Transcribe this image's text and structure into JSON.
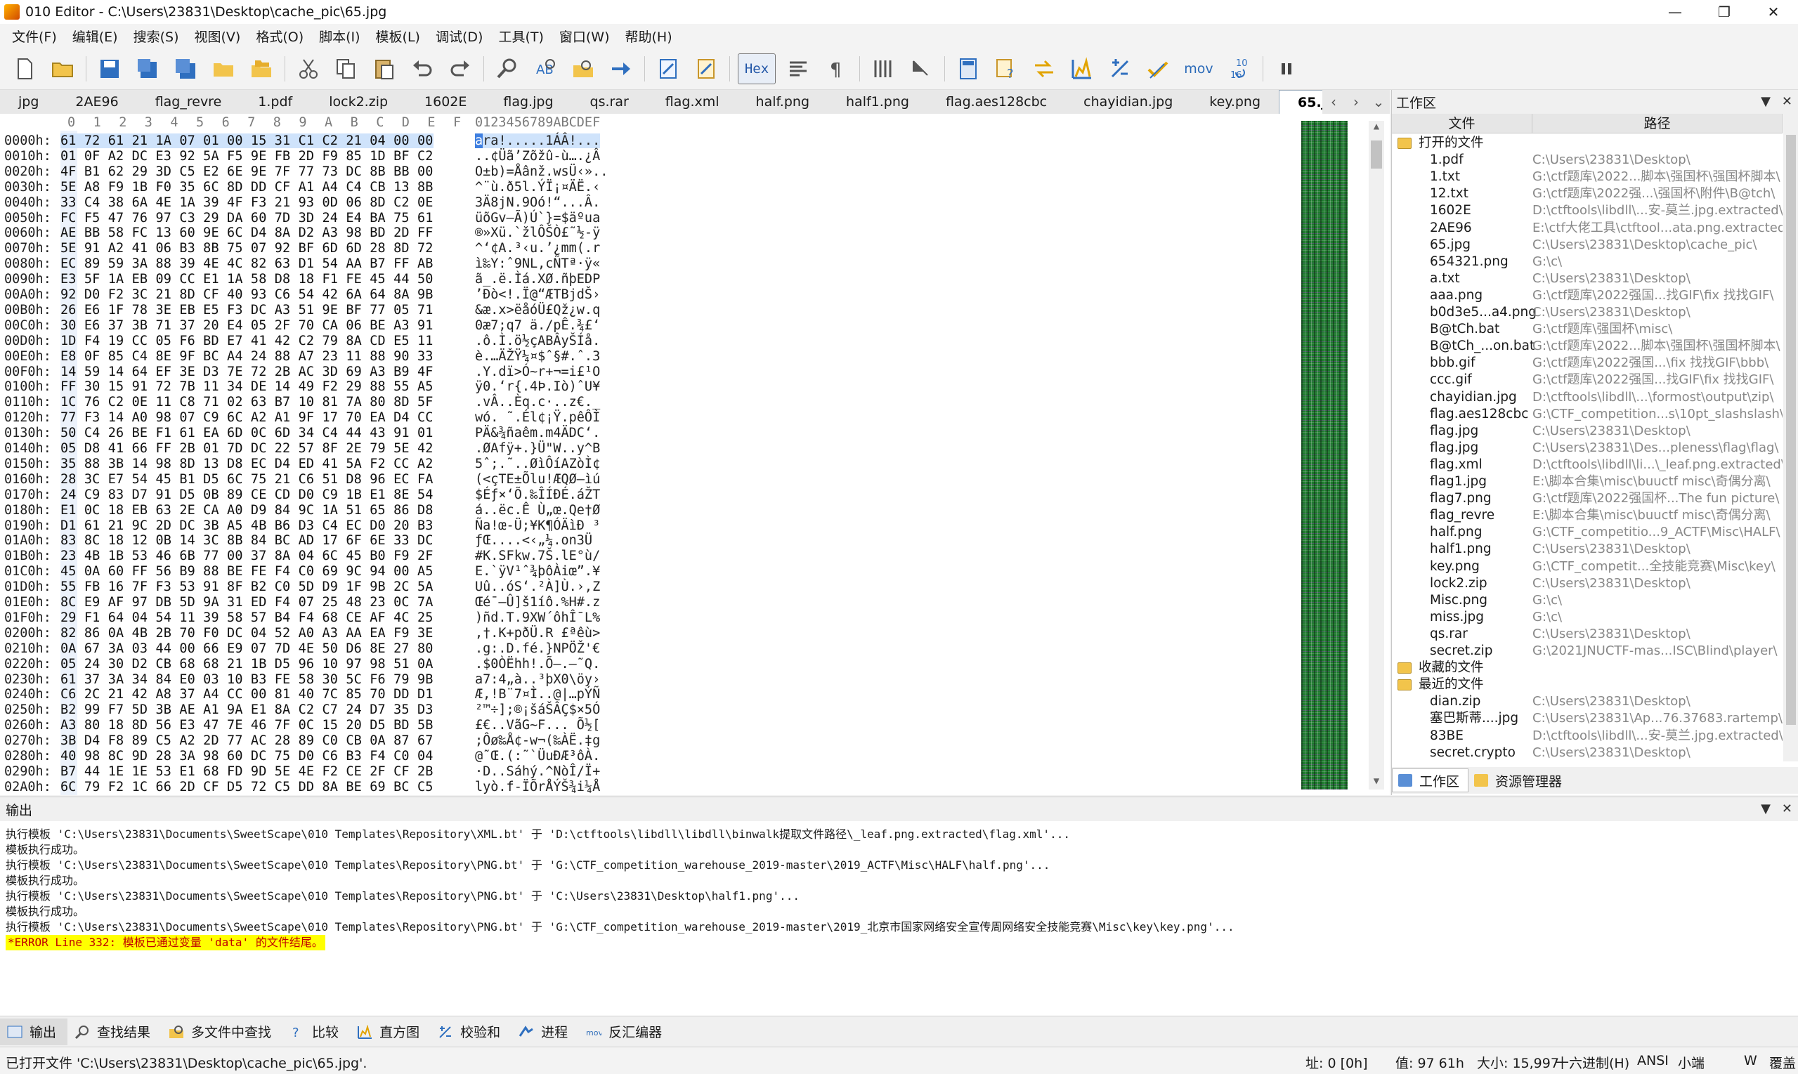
{
  "window": {
    "title": "010 Editor - C:\\Users\\23831\\Desktop\\cache_pic\\65.jpg",
    "min": "—",
    "max": "❐",
    "close": "✕"
  },
  "menu": [
    "文件(F)",
    "编辑(E)",
    "搜索(S)",
    "视图(V)",
    "格式(O)",
    "脚本(I)",
    "模板(L)",
    "调试(D)",
    "工具(T)",
    "窗口(W)",
    "帮助(H)"
  ],
  "toolbar": {
    "hex_label": "Hex",
    "mov_label": "mov",
    "counter_top": "10",
    "counter_bot": "16"
  },
  "tabs": [
    "jpg",
    "2AE96",
    "flag_revre",
    "1.pdf",
    "lock2.zip",
    "1602E",
    "flag.jpg",
    "qs.rar",
    "flag.xml",
    "half.png",
    "half1.png",
    "flag.aes128cbc",
    "chayidian.jpg",
    "key.png"
  ],
  "active_tab": {
    "label": "65.jpg",
    "close": "✕"
  },
  "tabnav": {
    "prev": "‹",
    "next": "›",
    "list": "⌄"
  },
  "hex": {
    "header_cols": [
      "0",
      "1",
      "2",
      "3",
      "4",
      "5",
      "6",
      "7",
      "8",
      "9",
      "A",
      "B",
      "C",
      "D",
      "E",
      "F"
    ],
    "ascii_header": "0123456789ABCDEF",
    "rows": [
      {
        "a": "0000h:",
        "b": "61 72 61 21 1A 07 01 00 15 31 C1 C2 21 04 00 00",
        "t": "ara!.....1ÁÂ!..."
      },
      {
        "a": "0010h:",
        "b": "01 0F A2 DC E3 92 5A F5 9E FB 2D F9 85 1D BF C2",
        "t": "..¢Üã’Zõž­û-ù….¿Â"
      },
      {
        "a": "0020h:",
        "b": "4F B1 62 29 3D C5 E2 6E 9E 7F 77 73 DC 8B BB 00",
        "t": "O±b)=Åânž.wsÜ‹».."
      },
      {
        "a": "0030h:",
        "b": "5E A8 F9 1B F0 35 6C 8D DD CF A1 A4 C4 CB 13 8B",
        "t": "^¨ù.ð5l.ÝÏ¡¤ÄË.‹"
      },
      {
        "a": "0040h:",
        "b": "33 C4 38 6A 4E 1A 39 4F F3 21 93 0D 06 8D C2 0E",
        "t": "3Ä8jN.9Oó!“...Â."
      },
      {
        "a": "0050h:",
        "b": "FC F5 47 76 97 C3 29 DA 60 7D 3D 24 E4 BA 75 61",
        "t": "üõGv—Ã)Ú`}=$äºua"
      },
      {
        "a": "0060h:",
        "b": "AE BB 58 FC 13 60 9E 6C D4 8A D2 A3 98 BD 2D FF",
        "t": "®»Xü.`žlÔŠÒ£˜½-ÿ"
      },
      {
        "a": "0070h:",
        "b": "5E 91 A2 41 06 B3 8B 75 07 92 BF 6D 6D 28 8D 72",
        "t": "^‘¢A.³‹u.’¿mm(.r"
      },
      {
        "a": "0080h:",
        "b": "EC 89 59 3A 88 39 4E 4C 82 63 D1 54 AA B7 FF AB",
        "t": "ì‰Y:ˆ9NL‚cÑTª·ÿ«"
      },
      {
        "a": "0090h:",
        "b": "E3 5F 1A EB 09 CC E1 1A 58 D8 18 F1 FE 45 44 50",
        "t": "ã_.ë.Ìá.XØ.ñþEDP"
      },
      {
        "a": "00A0h:",
        "b": "92 D0 F2 3C 21 8D CF 40 93 C6 54 42 6A 64 8A 9B",
        "t": "’Ðò<!.Ï@“ÆTBjdŠ›"
      },
      {
        "a": "00B0h:",
        "b": "26 E6 1F 78 3E EB E5 F3 DC A3 51 9E BF 77 05 71",
        "t": "&æ.x>ëåóÜ£Qž¿w.q"
      },
      {
        "a": "00C0h:",
        "b": "30 E6 37 3B 71 37 20 E4 05 2F 70 CA 06 BE A3 91",
        "t": "0æ7;q7 ä./pÊ.¾£‘"
      },
      {
        "a": "00D0h:",
        "b": "1D F4 19 CC 05 F6 BD E7 41 42 C2 79 8A CD E5 11",
        "t": ".ô.Ì.ö½çABÂyŠÍå."
      },
      {
        "a": "00E0h:",
        "b": "E8 0F 85 C4 8E 9F BC A4 24 88 A7 23 11 88 90 33",
        "t": "è.…ÄŽŸ¼¤$ˆ§#.ˆ.3"
      },
      {
        "a": "00F0h:",
        "b": "14 59 14 64 EF 3E D3 7E 72 2B AC 3D 69 A3 B9 4F",
        "t": ".Y.dï>Ó~r+¬=i£¹O"
      },
      {
        "a": "0100h:",
        "b": "FF 30 15 91 72 7B 11 34 DE 14 49 F2 29 88 55 A5",
        "t": "ÿ0.‘r{.4Þ.Iò)ˆU¥"
      },
      {
        "a": "0110h:",
        "b": "1C 76 C2 0E 11 C8 71 02 63 B7 10 81 7A 80 8D 5F",
        "t": ".vÂ..Èq.c·..z€._"
      },
      {
        "a": "0120h:",
        "b": "77 F3 14 A0 98 07 C9 6C A2 A1 9F 17 70 EA D4 CC",
        "t": "wó. ˜.Él¢¡Ÿ.pêÔÌ"
      },
      {
        "a": "0130h:",
        "b": "50 C4 26 BE F1 61 EA 6D 0C 6D 34 C4 44 43 91 01",
        "t": "PÄ&¾ñaêm.m4ÄDC‘."
      },
      {
        "a": "0140h:",
        "b": "05 D8 41 66 FF 2B 01 7D DC 22 57 8F 2E 79 5E 42",
        "t": ".ØAfÿ+.}Ü\"W..y^B"
      },
      {
        "a": "0150h:",
        "b": "35 88 3B 14 98 8D 13 D8 EC D4 ED 41 5A F2 CC A2",
        "t": "5ˆ;.˜..ØìÔíAZòÌ¢"
      },
      {
        "a": "0160h:",
        "b": "28 3C E7 54 45 B1 D5 6C 75 21 C6 51 D8 96 EC FA",
        "t": "(<çTE±Õlu!ÆQØ–ìú"
      },
      {
        "a": "0170h:",
        "b": "24 C9 83 D7 91 D5 0B 89 CE CD D0 C9 1B E1 8E 54",
        "t": "$Éƒ×‘Õ.‰ÎÍÐÉ.áŽT"
      },
      {
        "a": "0180h:",
        "b": "E1 0C 18 EB 63 2E CA A0 D9 84 9C 1A 51 65 86 D8",
        "t": "á..ëc.Ê Ù„œ.Qe†Ø"
      },
      {
        "a": "0190h:",
        "b": "D1 61 21 9C 2D DC 3B A5 4B B6 D3 C4 EC D0 20 B3",
        "t": "Ña!œ-Ü;¥K¶ÓÄìÐ ³"
      },
      {
        "a": "01A0h:",
        "b": "83 8C 18 12 0B 14 3C 8B 84 BC AD 17 6F 6E 33 DC",
        "t": "ƒŒ....<‹„¼­.on3Ü"
      },
      {
        "a": "01B0h:",
        "b": "23 4B 1B 53 46 6B 77 00 37 8A 04 6C 45 B0 F9 2F",
        "t": "#K.SFkw.7Š.lE°ù/"
      },
      {
        "a": "01C0h:",
        "b": "45 0A 60 FF 56 B9 88 BE FE F4 C0 69 9C 94 00 A5",
        "t": "E.`ÿV¹ˆ¾þôÀiœ”.¥"
      },
      {
        "a": "01D0h:",
        "b": "55 FB 16 7F F3 53 91 8F B2 C0 5D D9 1F 9B 2C 5A",
        "t": "Uû..óS‘.²À]Ù.›,Z"
      },
      {
        "a": "01E0h:",
        "b": "8C E9 AF 97 DB 5D 9A 31 ED F4 07 25 48 23 0C 7A",
        "t": "Œé¯—Û]š1íô.%H#.z"
      },
      {
        "a": "01F0h:",
        "b": "29 F1 64 04 54 11 39 58 57 B4 F4 68 CE AF 4C 25",
        "t": ")ñd.T.9XW´ôhÎ¯L%"
      },
      {
        "a": "0200h:",
        "b": "82 86 0A 4B 2B 70 F0 DC 04 52 A0 A3 AA EA F9 3E",
        "t": "‚†.K+pðÜ.R £ªêù>"
      },
      {
        "a": "0210h:",
        "b": "0A 67 3A 03 44 00 66 E9 07 7D 4E 50 D6 8E 27 80",
        "t": ".g:.D.fé.}NPÖŽ'€"
      },
      {
        "a": "0220h:",
        "b": "05 24 30 D2 CB 68 68 21 1B D5 96 10 97 98 51 0A",
        "t": ".$0ÒËhh!.Õ–.—˜Q."
      },
      {
        "a": "0230h:",
        "b": "61 37 3A 34 84 E0 03 10 B3 FE 58 30 5C F6 79 9B",
        "t": "a7:4„à..³þX0\\öy›"
      },
      {
        "a": "0240h:",
        "b": "C6 2C 21 42 A8 37 A4 CC 00 81 40 7C 85 70 DD D1",
        "t": "Æ,!B¨7¤Ì..@|…pÝÑ"
      },
      {
        "a": "0250h:",
        "b": "B2 99 F7 5D 3B AE A1 9A E1 8A C2 C7 24 D7 35 D3",
        "t": "²™÷];®¡šáŠÂÇ$×5Ó"
      },
      {
        "a": "0260h:",
        "b": "A3 80 18 8D 56 E3 47 7E 46 7F 0C 15 20 D5 BD 5B",
        "t": "£€..VãG~F... Õ½["
      },
      {
        "a": "0270h:",
        "b": "3B D4 F8 89 C5 A2 2D 77 AC 28 89 C0 CB 0A 87 67",
        "t": ";Ôø‰Å¢-w¬(‰ÀË.‡g"
      },
      {
        "a": "0280h:",
        "b": "40 98 8C 9D 28 3A 98 60 DC 75 D0 C6 B3 F4 C0 04",
        "t": "@˜Œ.(:˜`ÜuÐÆ³ôÀ."
      },
      {
        "a": "0290h:",
        "b": "B7 44 1E 1E 53 E1 68 FD 9D 5E 4E F2 CE 2F CF 2B",
        "t": "·D..Sáhý.^NòÎ/Ï+"
      },
      {
        "a": "02A0h:",
        "b": "6C 79 F2 1C 66 2D CF D5 72 C5 DD 8A BE 69 BC C5",
        "t": "lyò.f-ÏÕrÅÝŠ¾i¼Å"
      }
    ]
  },
  "workspace": {
    "title": "工作区",
    "col_file": "文件",
    "col_path": "路径",
    "group_open": "打开的文件",
    "open_files": [
      {
        "n": "1.pdf",
        "p": "C:\\Users\\23831\\Desktop\\"
      },
      {
        "n": "1.txt",
        "p": "G:\\ctf题库\\2022...脚本\\强国杯\\强国杯脚本\\"
      },
      {
        "n": "12.txt",
        "p": "G:\\ctf题库\\2022强...\\强国杯\\附件\\B@tch\\"
      },
      {
        "n": "1602E",
        "p": "D:\\ctftools\\libdll\\...安-莫兰.jpg.extracted\\"
      },
      {
        "n": "2AE96",
        "p": "E:\\ctf大佬工具\\ctftool...ata.png.extracted\\"
      },
      {
        "n": "65.jpg",
        "p": "C:\\Users\\23831\\Desktop\\cache_pic\\"
      },
      {
        "n": "654321.png",
        "p": "G:\\c\\"
      },
      {
        "n": "a.txt",
        "p": "C:\\Users\\23831\\Desktop\\"
      },
      {
        "n": "aaa.png",
        "p": "G:\\ctf题库\\2022强国...找GIF\\fix 找找GIF\\"
      },
      {
        "n": "b0d3e5...a4.png",
        "p": "C:\\Users\\23831\\Desktop\\"
      },
      {
        "n": "B@tCh.bat",
        "p": "G:\\ctf题库\\强国杯\\misc\\"
      },
      {
        "n": "B@tCh_...on.bat",
        "p": "G:\\ctf题库\\2022...脚本\\强国杯\\强国杯脚本\\"
      },
      {
        "n": "bbb.gif",
        "p": "G:\\ctf题库\\2022强国...\\fix 找找GIF\\bbb\\"
      },
      {
        "n": "ccc.gif",
        "p": "G:\\ctf题库\\2022强国...找GIF\\fix 找找GIF\\"
      },
      {
        "n": "chayidian.jpg",
        "p": "D:\\ctftools\\libdll\\...\\formost\\output\\zip\\"
      },
      {
        "n": "flag.aes128cbc",
        "p": "G:\\CTF_competition...s\\10pt_slashslash\\"
      },
      {
        "n": "flag.jpg",
        "p": "C:\\Users\\23831\\Desktop\\"
      },
      {
        "n": "flag.jpg",
        "p": "C:\\Users\\23831\\Des...pleness\\flag\\flag\\"
      },
      {
        "n": "flag.xml",
        "p": "D:\\ctftools\\libdll\\li...\\_leaf.png.extracted\\"
      },
      {
        "n": "flag1.jpg",
        "p": "E:\\脚本合集\\misc\\buuctf misc\\奇偶分离\\"
      },
      {
        "n": "flag7.png",
        "p": "G:\\ctf题库\\2022强国杯...The fun picture\\"
      },
      {
        "n": "flag_revre",
        "p": "E:\\脚本合集\\misc\\buuctf misc\\奇偶分离\\"
      },
      {
        "n": "half.png",
        "p": "G:\\CTF_competitio...9_ACTF\\Misc\\HALF\\"
      },
      {
        "n": "half1.png",
        "p": "C:\\Users\\23831\\Desktop\\"
      },
      {
        "n": "key.png",
        "p": "G:\\CTF_competit...全技能竞赛\\Misc\\key\\"
      },
      {
        "n": "lock2.zip",
        "p": "C:\\Users\\23831\\Desktop\\"
      },
      {
        "n": "Misc.png",
        "p": "G:\\c\\"
      },
      {
        "n": "miss.jpg",
        "p": "G:\\c\\"
      },
      {
        "n": "qs.rar",
        "p": "C:\\Users\\23831\\Desktop\\"
      },
      {
        "n": "secret.zip",
        "p": "G:\\2021JNUCTF-mas...ISC\\Blind\\player\\"
      }
    ],
    "group_fav": "收藏的文件",
    "group_recent": "最近的文件",
    "recent_files": [
      {
        "n": "dian.zip",
        "p": "C:\\Users\\23831\\Desktop\\"
      },
      {
        "n": "塞巴斯蒂....jpg",
        "p": "C:\\Users\\23831\\Ap...76.37683.rartemp\\"
      },
      {
        "n": "83BE",
        "p": "D:\\ctftools\\libdll\\...安-莫兰.jpg.extracted\\"
      },
      {
        "n": "secret.crypto",
        "p": "C:\\Users\\23831\\Desktop\\"
      }
    ],
    "tab_workspace": "工作区",
    "tab_explorer": "资源管理器"
  },
  "output": {
    "title": "输出",
    "lines": [
      "执行模板 'C:\\Users\\23831\\Documents\\SweetScape\\010 Templates\\Repository\\XML.bt' 于 'D:\\ctftools\\libdll\\libdll\\binwalk提取文件路径\\_leaf.png.extracted\\flag.xml'...",
      "模板执行成功。",
      "执行模板 'C:\\Users\\23831\\Documents\\SweetScape\\010 Templates\\Repository\\PNG.bt' 于 'G:\\CTF_competition_warehouse_2019-master\\2019_ACTF\\Misc\\HALF\\half.png'...",
      "模板执行成功。",
      "执行模板 'C:\\Users\\23831\\Documents\\SweetScape\\010 Templates\\Repository\\PNG.bt' 于 'C:\\Users\\23831\\Desktop\\half1.png'...",
      "模板执行成功。",
      "执行模板 'C:\\Users\\23831\\Documents\\SweetScape\\010 Templates\\Repository\\PNG.bt' 于 'G:\\CTF_competition_warehouse_2019-master\\2019_北京市国家网络安全宣传周网络安全技能竞赛\\Misc\\key\\key.png'..."
    ],
    "error": "*ERROR Line 332: 模板已通过变量 'data' 的文件结尾。"
  },
  "bottom_tabs": [
    "输出",
    "查找结果",
    "多文件中查找",
    "比较",
    "直方图",
    "校验和",
    "进程",
    "反汇编器"
  ],
  "status": {
    "message": "已打开文件 'C:\\Users\\23831\\Desktop\\cache_pic\\65.jpg'.",
    "addr": "址: 0 [0h]",
    "value": "值: 97 61h",
    "size": "大小: 15,997",
    "mode": "十六进制(H)",
    "encoding": "ANSI",
    "endian": "小端",
    "w": "W",
    "overwrite": "覆盖"
  },
  "colors": {
    "accent": "#3f7fe0",
    "error_bg": "#ffff00",
    "error_fg": "#c00000",
    "bytemap": "#1d7a2d"
  }
}
